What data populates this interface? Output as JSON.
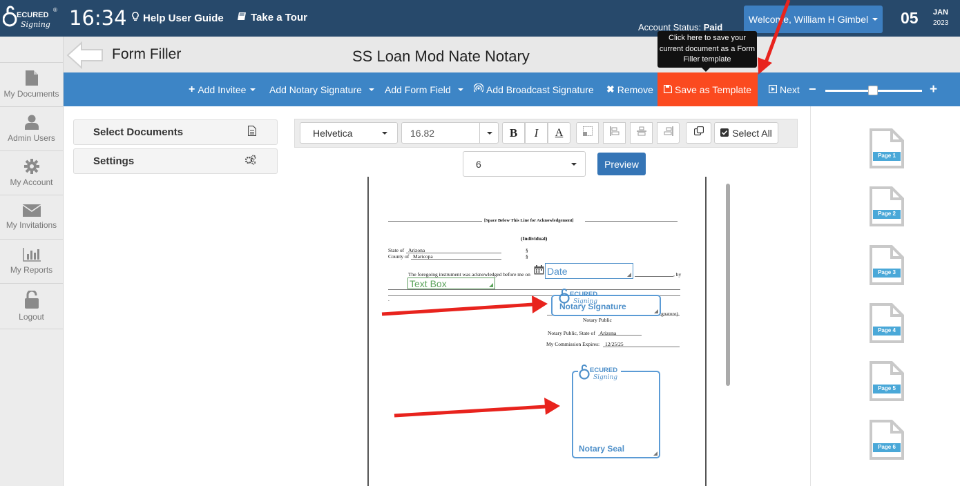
{
  "header": {
    "clock": "16:34",
    "help_link": "Help User Guide",
    "tour_link": "Take a Tour",
    "account_status_label": "Account Status:",
    "account_status_value": "Paid",
    "welcome": "Welcome,  William H Gimbel",
    "date_day": "05",
    "date_month": "JAN",
    "date_year": "2023",
    "logo_text_1": "ECURED",
    "logo_text_2": "Signing"
  },
  "sidebar": {
    "items": [
      {
        "label": "My Documents",
        "icon": "document-icon"
      },
      {
        "label": "Admin Users",
        "icon": "user-icon"
      },
      {
        "label": "My Account",
        "icon": "gear-icon"
      },
      {
        "label": "My Invitations",
        "icon": "envelope-icon"
      },
      {
        "label": "My Reports",
        "icon": "bar-chart-icon"
      },
      {
        "label": "Logout",
        "icon": "lock-icon"
      }
    ]
  },
  "page": {
    "section_title": "Form Filler",
    "document_title": "SS Loan Mod Nate Notary",
    "tooltip": "Click here to save your current document as a Form Filler template"
  },
  "toolbar": {
    "add_invitee": "Add Invitee",
    "add_notary_signature": "Add Notary Signature",
    "add_form_field": "Add Form Field",
    "add_broadcast_signature": "Add Broadcast Signature",
    "remove": "Remove",
    "save_as_template": "Save as Template",
    "next": "Next",
    "zoom_minus": "−",
    "zoom_plus": "+",
    "zoom_level": 0.5
  },
  "left_panel": {
    "select_documents": "Select Documents",
    "settings": "Settings"
  },
  "format_bar": {
    "font": "Helvetica",
    "font_size": "16.82",
    "bold": "B",
    "italic": "I",
    "color": "A",
    "select_all": "Select All",
    "page_select": "6",
    "preview": "Preview"
  },
  "document": {
    "space_line": "[Space Below This Line for Acknowledgement]",
    "individual": "(Individual)",
    "state_of_label": "State of",
    "state_of_value": "Arizona",
    "county_of_label": "County of",
    "county_of_value": "Maricopa",
    "section_mark": "§",
    "foregoing": "The foregoing instrument was acknowledged before  me on",
    "by": ", by",
    "dot": ".",
    "signature_suffix": "gnature)",
    "notary_public": "Notary Public",
    "notary_state_label": "Notary Public, State of",
    "notary_state_value": "Arizona",
    "commission_label": "My Commission Expires:",
    "commission_value": "12/25/25"
  },
  "fields": {
    "date": "Date",
    "text_box": "Text Box",
    "notary_signature": "Notary Signature",
    "notary_seal": "Notary Seal"
  },
  "thumbnails": [
    "Page 1",
    "Page 2",
    "Page 3",
    "Page 4",
    "Page 5",
    "Page 6"
  ],
  "colors": {
    "topbar": "#27496b",
    "toolbar": "#3d85c6",
    "save_template": "#fb4a1f",
    "arrow": "#e8231d",
    "field_green": "#5ba35b",
    "notary_blue": "#5b9bd5"
  }
}
